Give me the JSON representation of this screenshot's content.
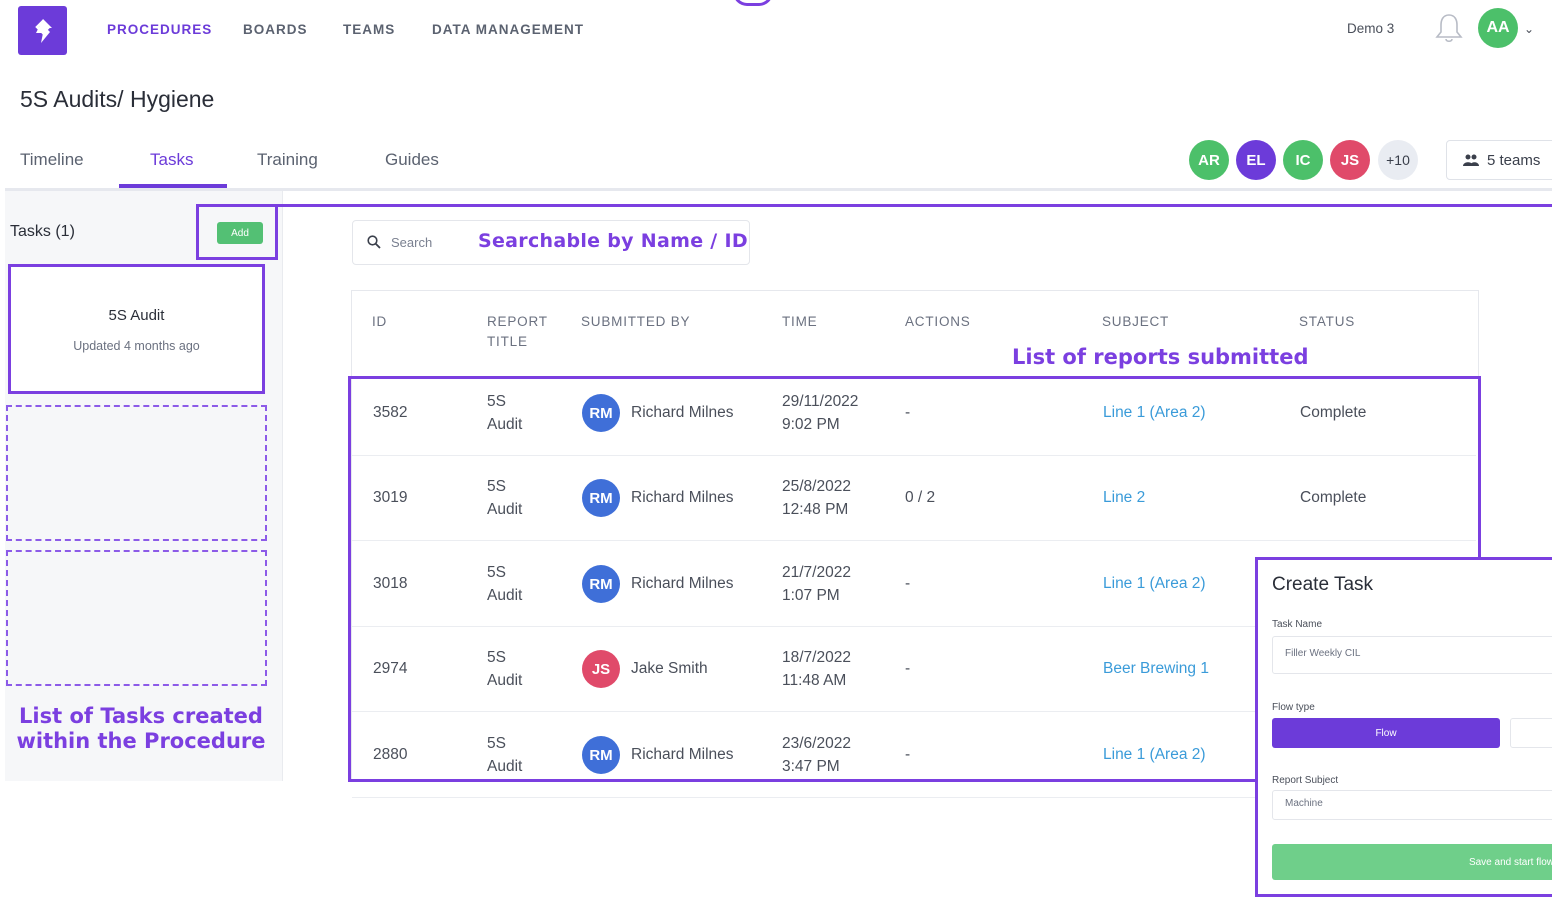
{
  "nav": {
    "items": [
      "PROCEDURES",
      "BOARDS",
      "TEAMS",
      "DATA MANAGEMENT"
    ],
    "workspace": "Demo 3",
    "user_initials": "AA",
    "logo_icon": "logo-icon",
    "bell_icon": "bell-icon"
  },
  "page": {
    "title": "5S Audits/ Hygiene",
    "tabs": [
      "Timeline",
      "Tasks",
      "Training",
      "Guides"
    ],
    "active_tab": "Tasks",
    "members": [
      {
        "initials": "AR",
        "color": "#4cc06a"
      },
      {
        "initials": "EL",
        "color": "#6c3bd9"
      },
      {
        "initials": "IC",
        "color": "#4cc06a"
      },
      {
        "initials": "JS",
        "color": "#e04a6a"
      }
    ],
    "members_more": "+10",
    "teams_label": "5 teams"
  },
  "tasks_panel": {
    "count_label": "Tasks (1)",
    "add_label": "Add",
    "tasks": [
      {
        "name": "5S Audit",
        "updated": "Updated 4 months ago"
      }
    ]
  },
  "search": {
    "placeholder": "Search"
  },
  "annotations": {
    "search": "Searchable by Name / ID",
    "reports": "List of reports submitted",
    "tasks_line1": "List of Tasks created",
    "tasks_line2": "within the Procedure"
  },
  "table": {
    "headers": {
      "id": "ID",
      "report_title_1": "REPORT",
      "report_title_2": "TITLE",
      "submitted_by": "SUBMITTED BY",
      "time": "TIME",
      "actions": "ACTIONS",
      "subject": "SUBJECT",
      "status": "STATUS"
    },
    "rows": [
      {
        "id": "3582",
        "title1": "5S",
        "title2": "Audit",
        "initials": "RM",
        "avatar_color": "#3f6fd8",
        "name": "Richard Milnes",
        "date": "29/11/2022",
        "time": "9:02 PM",
        "actions": "-",
        "subject": "Line 1 (Area 2)",
        "status": "Complete"
      },
      {
        "id": "3019",
        "title1": "5S",
        "title2": "Audit",
        "initials": "RM",
        "avatar_color": "#3f6fd8",
        "name": "Richard Milnes",
        "date": "25/8/2022",
        "time": "12:48 PM",
        "actions": "0 / 2",
        "subject": "Line 2",
        "status": "Complete"
      },
      {
        "id": "3018",
        "title1": "5S",
        "title2": "Audit",
        "initials": "RM",
        "avatar_color": "#3f6fd8",
        "name": "Richard Milnes",
        "date": "21/7/2022",
        "time": "1:07 PM",
        "actions": "-",
        "subject": "Line 1 (Area 2)",
        "status": ""
      },
      {
        "id": "2974",
        "title1": "5S",
        "title2": "Audit",
        "initials": "JS",
        "avatar_color": "#e04a6a",
        "name": "Jake Smith",
        "date": "18/7/2022",
        "time": "11:48 AM",
        "actions": "-",
        "subject": "Beer Brewing 1",
        "status": ""
      },
      {
        "id": "2880",
        "title1": "5S",
        "title2": "Audit",
        "initials": "RM",
        "avatar_color": "#3f6fd8",
        "name": "Richard Milnes",
        "date": "23/6/2022",
        "time": "3:47 PM",
        "actions": "-",
        "subject": "Line 1 (Area 2)",
        "status": ""
      }
    ]
  },
  "create_task": {
    "title": "Create Task",
    "task_name_label": "Task Name",
    "task_name_value": "Filler Weekly CIL",
    "flow_type_label": "Flow type",
    "flow_option": "Flow",
    "report_subject_label": "Report Subject",
    "report_subject_value": "Machine",
    "save_label": "Save and start flow"
  }
}
